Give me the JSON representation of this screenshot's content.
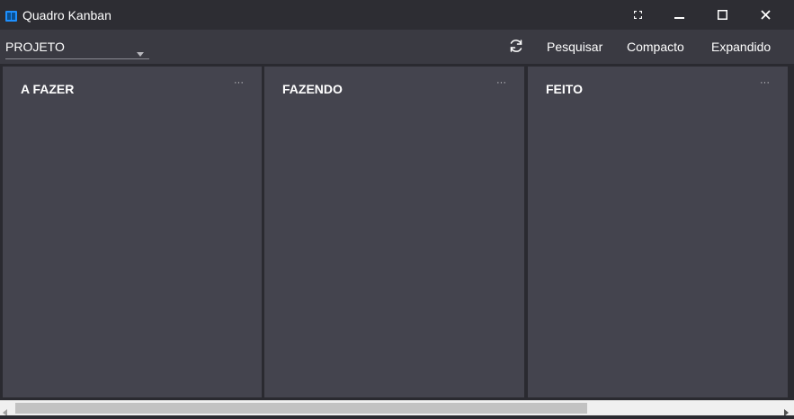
{
  "window": {
    "title": "Quadro Kanban",
    "icon": "kanban-board-icon",
    "controls": [
      "fullscreen-icon",
      "minimize-icon",
      "maximize-icon",
      "close-icon"
    ]
  },
  "toolbar": {
    "project_select_value": "PROJETO",
    "refresh_icon": "refresh-icon",
    "search_label": "Pesquisar",
    "compact_label": "Compacto",
    "expanded_label": "Expandido"
  },
  "columns": [
    {
      "title": "A FAZER",
      "menu": "···"
    },
    {
      "title": "FAZENDO",
      "menu": "···"
    },
    {
      "title": "FEITO",
      "menu": "···"
    }
  ],
  "scrollbar": {
    "position_fraction": 0.0,
    "visible_fraction": 0.74
  },
  "colors": {
    "titlebar": "#2d2d33",
    "toolbar": "#3a3a42",
    "column_bg": "#44444e",
    "board_bg": "#2a2a30",
    "accent_icon": "#1e90ff"
  }
}
